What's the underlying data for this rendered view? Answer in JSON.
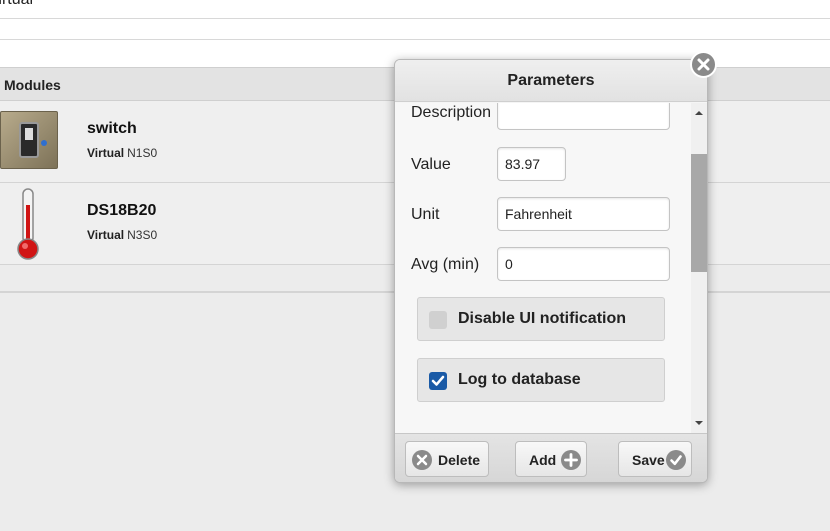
{
  "page": {
    "breadcrumb": "Virtual",
    "modules_header": "Modules"
  },
  "modules": [
    {
      "name": "switch",
      "type": "Virtual",
      "id": "N1S0",
      "icon": "wall-switch-icon"
    },
    {
      "name": "DS18B20",
      "type": "Virtual",
      "id": "N3S0",
      "icon": "thermometer-icon"
    }
  ],
  "dialog": {
    "title": "Parameters",
    "fields": {
      "description": {
        "label": "Description",
        "value": ""
      },
      "value": {
        "label": "Value",
        "value": "83.97"
      },
      "unit": {
        "label": "Unit",
        "value": "Fahrenheit"
      },
      "avg": {
        "label": "Avg (min)",
        "value": "0"
      }
    },
    "checkboxes": {
      "disable_ui": {
        "label": "Disable UI notification",
        "checked": false
      },
      "log_db": {
        "label": "Log to database",
        "checked": true
      }
    },
    "buttons": {
      "delete": "Delete",
      "add": "Add",
      "save": "Save"
    }
  },
  "colors": {
    "accent": "#1a5aa6",
    "thermometer_red": "#d01414"
  }
}
